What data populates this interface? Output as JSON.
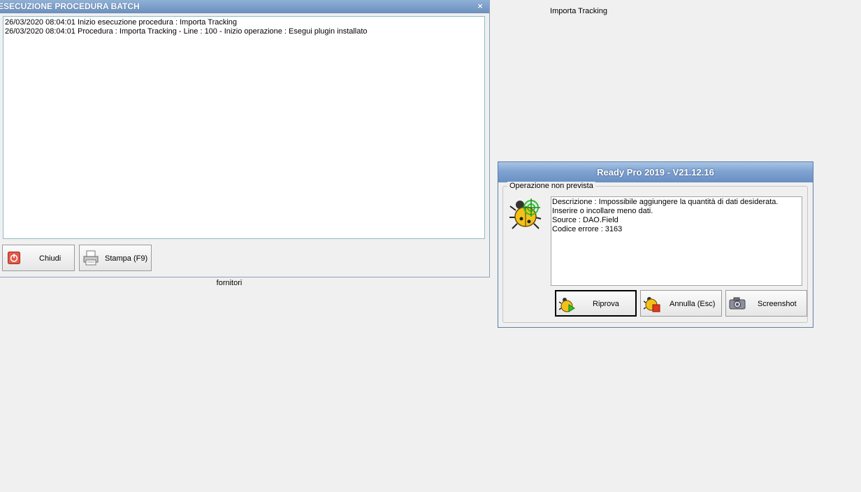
{
  "desktop": {
    "importa_tracking_label": "Importa Tracking",
    "fornitori_label": "fornitori"
  },
  "batch_window": {
    "title": "ESECUZIONE PROCEDURA BATCH",
    "close_symbol": "×",
    "log_lines": [
      "26/03/2020 08:04:01 Inizio esecuzione procedura : Importa Tracking",
      "26/03/2020 08:04:01 Procedura : Importa Tracking - Line : 100 - Inizio operazione : Esegui plugin installato"
    ],
    "buttons": {
      "chiudi": "Chiudi",
      "stampa": "Stampa (F9)"
    },
    "icons": {
      "chiudi": "power-icon",
      "stampa": "printer-icon"
    }
  },
  "error_dialog": {
    "title": "Ready Pro 2019 - V21.12.16",
    "group_label": "Operazione non prevista",
    "message_lines": [
      "Descrizione : Impossibile aggiungere la quantità di dati desiderata. Inserire o incollare meno dati.",
      "Source : DAO.Field",
      "Codice errore : 3163"
    ],
    "buttons": {
      "riprova": "Riprova",
      "annulla": "Annulla (Esc)",
      "screenshot": "Screenshot"
    },
    "icons": {
      "main": "bug-target-icon",
      "riprova": "bug-go-icon",
      "annulla": "bug-stop-icon",
      "screenshot": "camera-icon"
    }
  },
  "colors": {
    "title_bar": "#6b8fbd",
    "dialog_border": "#5c7fa8",
    "bug_yellow": "#f2c21b",
    "target_green": "#2ec02e",
    "stop_red": "#e03a1e"
  }
}
